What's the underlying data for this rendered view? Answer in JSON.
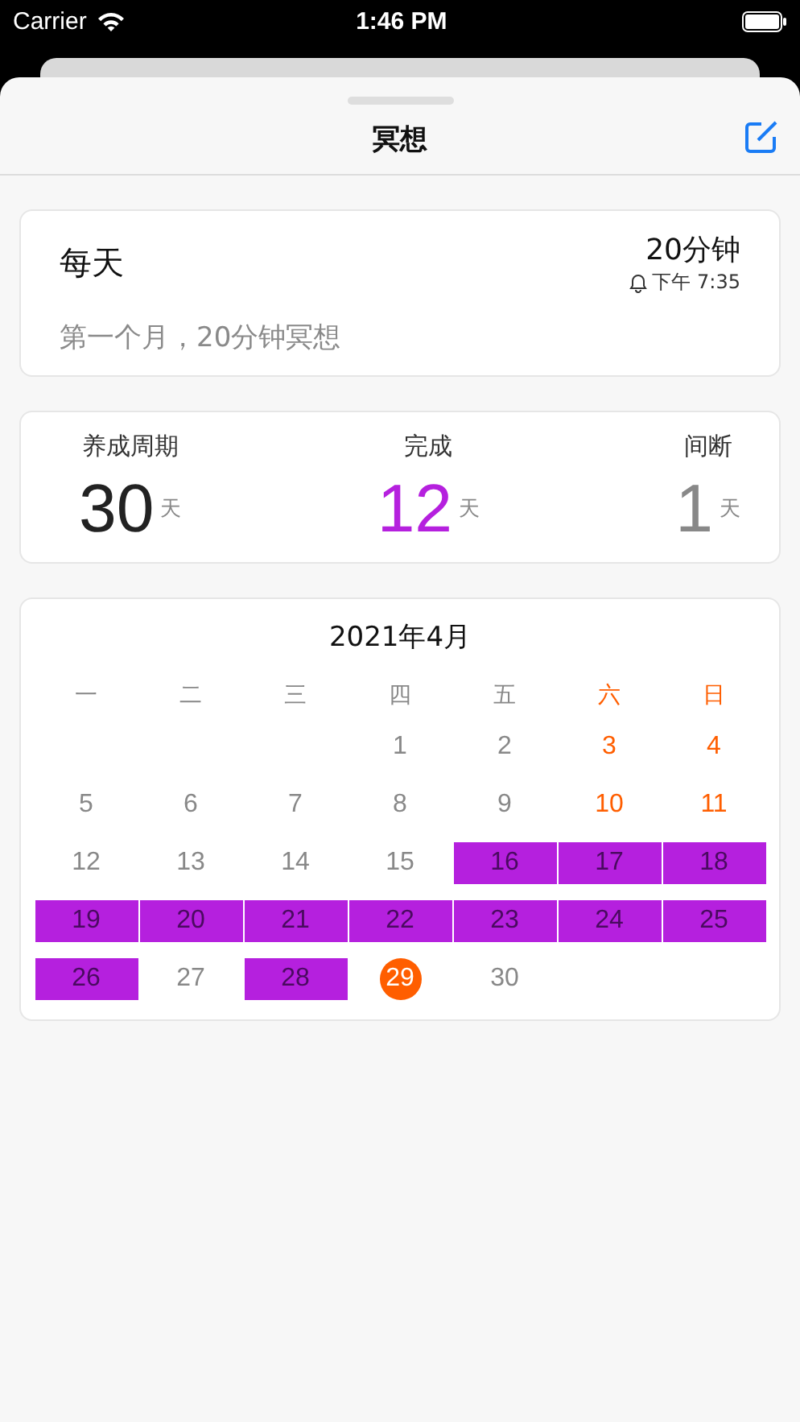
{
  "status_bar": {
    "carrier": "Carrier",
    "time": "1:46 PM"
  },
  "nav": {
    "title": "冥想"
  },
  "habit": {
    "frequency": "每天",
    "duration": "20分钟",
    "reminder": "下午 7:35",
    "note": "第一个月，20分钟冥想"
  },
  "stats": [
    {
      "label": "养成周期",
      "value": "30",
      "unit": "天",
      "kind": "total"
    },
    {
      "label": "完成",
      "value": "12",
      "unit": "天",
      "kind": "done"
    },
    {
      "label": "间断",
      "value": "1",
      "unit": "天",
      "kind": "missed"
    }
  ],
  "calendar": {
    "title": "2021年4月",
    "weekdays": [
      {
        "label": "一",
        "weekend": false
      },
      {
        "label": "二",
        "weekend": false
      },
      {
        "label": "三",
        "weekend": false
      },
      {
        "label": "四",
        "weekend": false
      },
      {
        "label": "五",
        "weekend": false
      },
      {
        "label": "六",
        "weekend": true
      },
      {
        "label": "日",
        "weekend": true
      }
    ],
    "days": [
      {
        "kind": "empty"
      },
      {
        "kind": "empty"
      },
      {
        "kind": "empty"
      },
      {
        "kind": "day",
        "label": "1"
      },
      {
        "kind": "day",
        "label": "2"
      },
      {
        "kind": "day",
        "label": "3"
      },
      {
        "kind": "day",
        "label": "4"
      },
      {
        "kind": "day",
        "label": "5"
      },
      {
        "kind": "day",
        "label": "6"
      },
      {
        "kind": "day",
        "label": "7"
      },
      {
        "kind": "day",
        "label": "8"
      },
      {
        "kind": "day",
        "label": "9"
      },
      {
        "kind": "day",
        "label": "10"
      },
      {
        "kind": "day",
        "label": "11"
      },
      {
        "kind": "day",
        "label": "12"
      },
      {
        "kind": "day",
        "label": "13"
      },
      {
        "kind": "day",
        "label": "14"
      },
      {
        "kind": "day",
        "label": "15"
      },
      {
        "kind": "done",
        "label": "16"
      },
      {
        "kind": "done",
        "label": "17"
      },
      {
        "kind": "done",
        "label": "18"
      },
      {
        "kind": "done",
        "label": "19"
      },
      {
        "kind": "done",
        "label": "20"
      },
      {
        "kind": "done",
        "label": "21"
      },
      {
        "kind": "done",
        "label": "22"
      },
      {
        "kind": "done",
        "label": "23"
      },
      {
        "kind": "done",
        "label": "24"
      },
      {
        "kind": "done",
        "label": "25"
      },
      {
        "kind": "done",
        "label": "26"
      },
      {
        "kind": "day",
        "label": "27"
      },
      {
        "kind": "done",
        "label": "28"
      },
      {
        "kind": "today",
        "label": "29"
      },
      {
        "kind": "day",
        "label": "30"
      }
    ]
  }
}
